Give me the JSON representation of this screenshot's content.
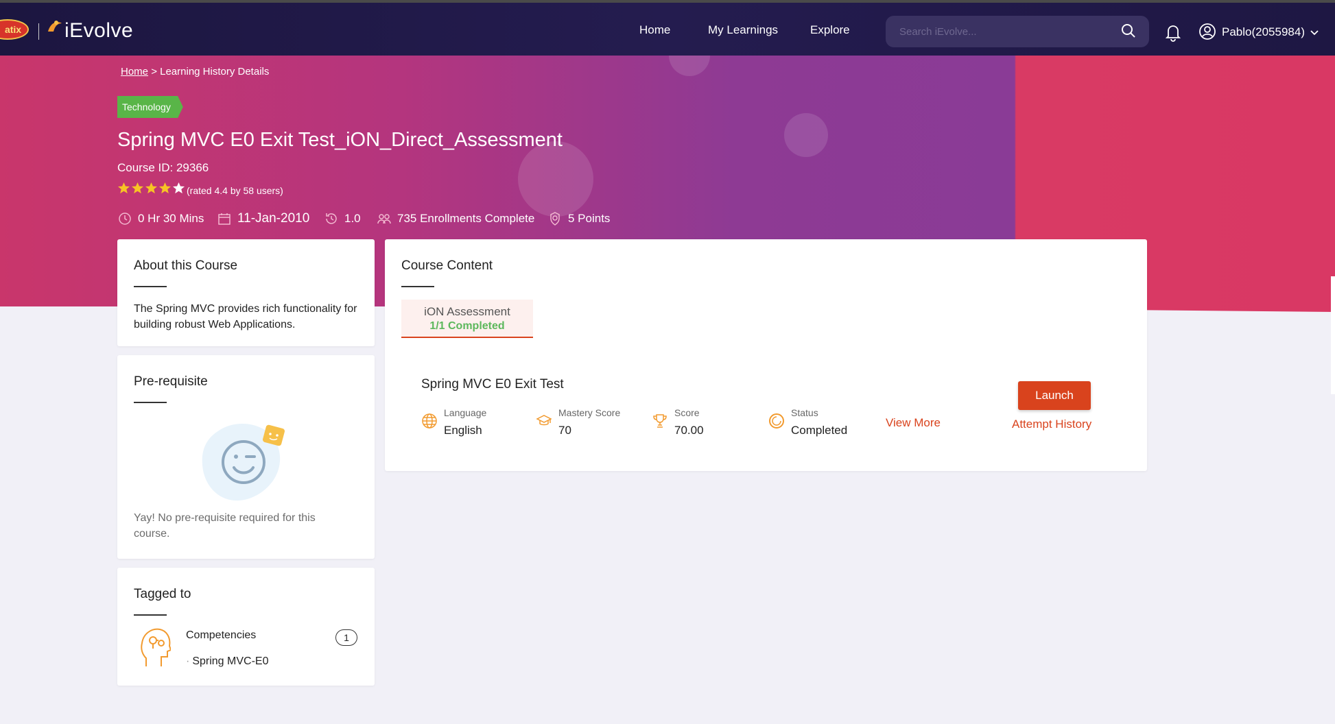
{
  "header": {
    "brand_badge": "atix",
    "brand_name": "iEvolve",
    "nav": [
      "Home",
      "My Learnings",
      "Explore"
    ],
    "search_placeholder": "Search iEvolve...",
    "user_name": "Pablo(2055984)"
  },
  "breadcrumb": {
    "home": "Home",
    "separator": ">",
    "current": "Learning History Details"
  },
  "course": {
    "category": "Technology",
    "title": "Spring MVC E0 Exit Test_iON_Direct_Assessment",
    "course_id": "Course ID: 29366",
    "rating": 4.4,
    "rating_text": "(rated 4.4 by 58 users)",
    "duration": "0 Hr 30 Mins",
    "date": "11-Jan-2010",
    "version": "1.0",
    "enrollments": "735 Enrollments Complete",
    "points": "5 Points"
  },
  "about": {
    "title": "About this Course",
    "text": "The Spring MVC provides rich functionality for building robust Web Applications."
  },
  "prerequisite": {
    "title": "Pre-requisite",
    "text": "Yay! No pre-requisite required for this course."
  },
  "tagged": {
    "title": "Tagged to",
    "competencies_label": "Competencies",
    "count": "1",
    "items": [
      "Spring MVC-E0"
    ]
  },
  "content": {
    "title": "Course Content",
    "tab_label": "iON Assessment",
    "tab_status": "1/1 Completed",
    "item_title": "Spring MVC E0 Exit Test",
    "language_label": "Language",
    "language": "English",
    "mastery_label": "Mastery Score",
    "mastery": "70",
    "score_label": "Score",
    "score": "70.00",
    "status_label": "Status",
    "status": "Completed",
    "view_more": "View More",
    "launch": "Launch",
    "attempt_history": "Attempt History"
  },
  "colors": {
    "accent": "#d9431d",
    "success": "#59b548",
    "nav_bg": "#1e1743",
    "icon_orange": "#f29a2e"
  }
}
